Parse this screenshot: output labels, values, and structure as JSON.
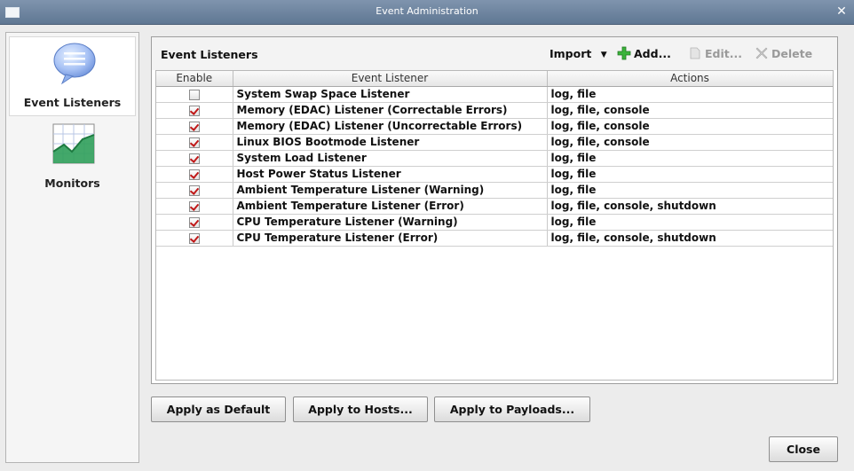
{
  "window": {
    "title": "Event Administration"
  },
  "nav": {
    "items": [
      {
        "label": "Event Listeners",
        "icon": "speech-bubble-icon",
        "selected": true
      },
      {
        "label": "Monitors",
        "icon": "chart-grid-icon",
        "selected": false
      }
    ]
  },
  "panel": {
    "title": "Event Listeners",
    "toolbar": {
      "import_label": "Import",
      "add_label": "Add...",
      "edit_label": "Edit...",
      "delete_label": "Delete"
    },
    "columns": [
      "Enable",
      "Event Listener",
      "Actions"
    ],
    "rows": [
      {
        "enabled": false,
        "listener": "System Swap Space Listener",
        "actions": "log, file"
      },
      {
        "enabled": true,
        "listener": "Memory (EDAC) Listener (Correctable Errors)",
        "actions": "log, file, console"
      },
      {
        "enabled": true,
        "listener": "Memory (EDAC) Listener (Uncorrectable Errors)",
        "actions": "log, file, console"
      },
      {
        "enabled": true,
        "listener": "Linux BIOS Bootmode Listener",
        "actions": "log, file, console"
      },
      {
        "enabled": true,
        "listener": "System Load Listener",
        "actions": "log, file"
      },
      {
        "enabled": true,
        "listener": "Host Power Status Listener",
        "actions": "log, file"
      },
      {
        "enabled": true,
        "listener": "Ambient Temperature Listener (Warning)",
        "actions": "log, file"
      },
      {
        "enabled": true,
        "listener": "Ambient Temperature Listener (Error)",
        "actions": "log, file, console, shutdown"
      },
      {
        "enabled": true,
        "listener": "CPU Temperature Listener (Warning)",
        "actions": "log, file"
      },
      {
        "enabled": true,
        "listener": "CPU Temperature Listener (Error)",
        "actions": "log, file, console, shutdown"
      }
    ]
  },
  "buttons": {
    "apply_default": "Apply as Default",
    "apply_hosts": "Apply to Hosts...",
    "apply_payloads": "Apply to Payloads...",
    "close": "Close"
  }
}
